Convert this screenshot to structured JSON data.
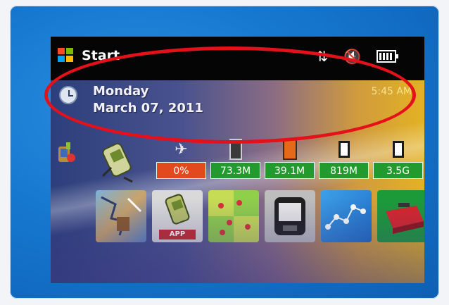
{
  "taskbar": {
    "start_label": "Start",
    "icons": [
      "connectivity-icon",
      "volume-mute-icon",
      "battery-icon"
    ]
  },
  "today": {
    "day": "Monday",
    "date": "March 07, 2011",
    "time": "5:45 AM"
  },
  "stats": [
    {
      "icon": "signal-icon",
      "value": "0%",
      "color": "#e24a1d"
    },
    {
      "icon": "phone-icon",
      "value": "73.3M",
      "color": "#239a2d"
    },
    {
      "icon": "memory-icon",
      "value": "39.1M",
      "color": "#239a2d"
    },
    {
      "icon": "storage-card-icon",
      "value": "819M",
      "color": "#239a2d"
    },
    {
      "icon": "storage-card-2-icon",
      "value": "3.5G",
      "color": "#239a2d"
    }
  ],
  "apps": [
    {
      "name": "map-app-icon"
    },
    {
      "name": "gps-app-icon",
      "badge": "APP"
    },
    {
      "name": "green-map-icon"
    },
    {
      "name": "device-icon"
    },
    {
      "name": "route-icon"
    },
    {
      "name": "toolbox-icon"
    }
  ],
  "annotation_color": "#e4101a"
}
